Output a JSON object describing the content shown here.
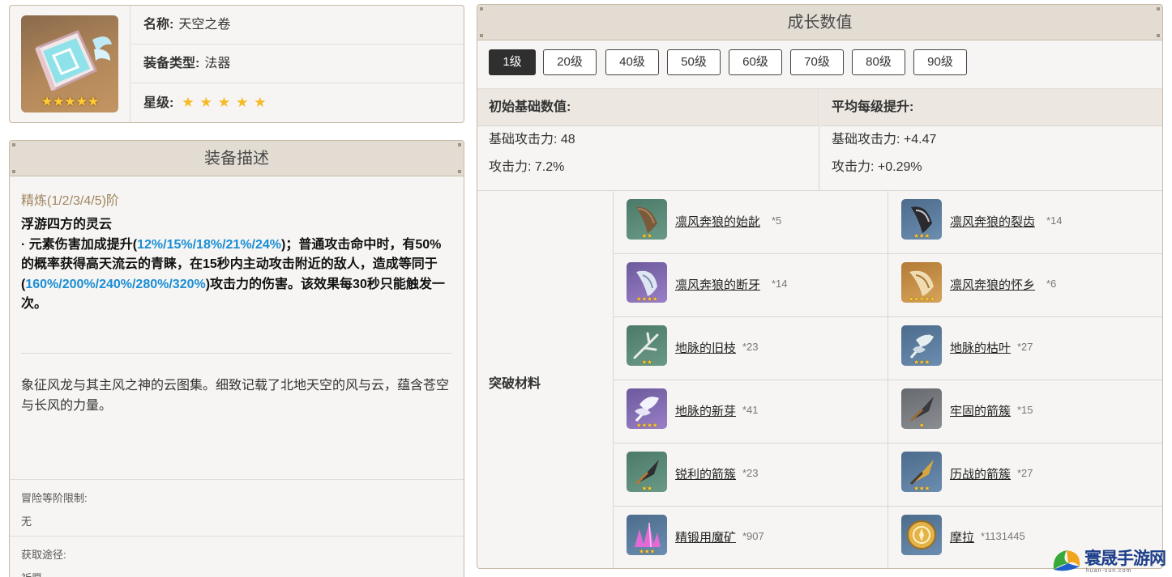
{
  "item": {
    "name_label": "名称:",
    "name": "天空之卷",
    "type_label": "装备类型:",
    "type": "法器",
    "rarity_label": "星级:",
    "rarity_stars": "★★★★★",
    "icon_stars": "★★★★★"
  },
  "description": {
    "header": "装备描述",
    "refine": "精炼(1/2/3/4/5)阶",
    "skill_title": "浮游四方的灵云",
    "skill_p1": "· 元素伤害加成提升(",
    "skill_v1": "12%/15%/18%/21%/24%",
    "skill_p2": ")；普通攻击命中时，有50%的概率获得高天流云的青睐，在15秒内主动攻击附近的敌人，造成等同于(",
    "skill_v2": "160%/200%/240%/280%/320%",
    "skill_p3": ")攻击力的伤害。该效果每30秒只能触发一次。",
    "lore": "象征风龙与其主风之神的云图集。细致记载了北地天空的风与云，蕴含苍空与长风的力量。",
    "rank_limit_label": "冒险等阶限制:",
    "rank_limit": "无",
    "source_label": "获取途径:",
    "source": "祈愿"
  },
  "growth": {
    "header": "成长数值",
    "levels": [
      "1级",
      "20级",
      "40级",
      "50级",
      "60级",
      "70级",
      "80级",
      "90级"
    ],
    "active_level": "1级",
    "base_head": "初始基础数值:",
    "base_atk": "基础攻击力: 48",
    "base_sub": "攻击力: 7.2%",
    "avg_head": "平均每级提升:",
    "avg_atk": "基础攻击力: +4.47",
    "avg_sub": "攻击力: +0.29%",
    "materials_label": "突破材料",
    "materials": [
      {
        "name": "凛风奔狼的始龀",
        "count": "*5",
        "stars": "★★",
        "icon": "tooth-icon"
      },
      {
        "name": "凛风奔狼的裂齿",
        "count": "*14",
        "stars": "★★★",
        "icon": "tooth-icon"
      },
      {
        "name": "凛风奔狼的断牙",
        "count": "*14",
        "stars": "★★★★",
        "icon": "tooth-icon"
      },
      {
        "name": "凛风奔狼的怀乡",
        "count": "*6",
        "stars": "★★★★★",
        "icon": "tooth-icon"
      },
      {
        "name": "地脉的旧枝",
        "count": "*23",
        "stars": "★★",
        "icon": "branch-icon"
      },
      {
        "name": "地脉的枯叶",
        "count": "*27",
        "stars": "★★★",
        "icon": "leaf-icon"
      },
      {
        "name": "地脉的新芽",
        "count": "*41",
        "stars": "★★★★",
        "icon": "sprout-icon"
      },
      {
        "name": "牢固的箭簇",
        "count": "*15",
        "stars": "★",
        "icon": "arrowhead-icon"
      },
      {
        "name": "锐利的箭簇",
        "count": "*23",
        "stars": "★★",
        "icon": "arrowhead-icon"
      },
      {
        "name": "历战的箭簇",
        "count": "*27",
        "stars": "★★★",
        "icon": "arrowhead-icon"
      },
      {
        "name": "精锻用魔矿",
        "count": "*907",
        "stars": "★★★",
        "icon": "crystal-ore-icon"
      },
      {
        "name": "摩拉",
        "count": "*1131445",
        "stars": "",
        "icon": "mora-coin-icon"
      }
    ]
  },
  "watermark": {
    "text": "寰晟手游网",
    "sub": "huan-sun.com"
  }
}
